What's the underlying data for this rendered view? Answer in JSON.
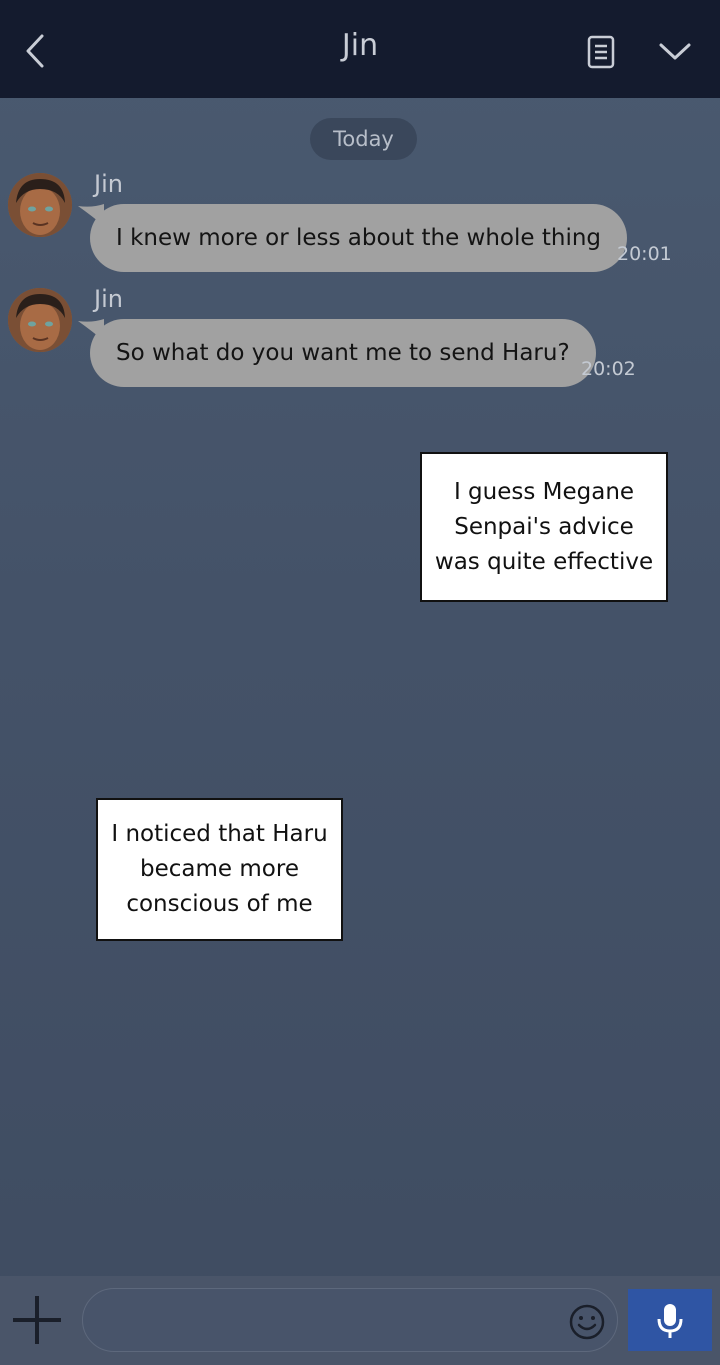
{
  "header": {
    "title": "Jin",
    "back_icon": "chevron-left-icon",
    "notes_icon": "document-icon",
    "collapse_icon": "chevron-down-icon"
  },
  "date_divider": "Today",
  "messages": [
    {
      "sender": "Jin",
      "text": "I knew more or less about the whole thing",
      "time": "20:01"
    },
    {
      "sender": "Jin",
      "text": "So what do you want me to send Haru?",
      "time": "20:02"
    }
  ],
  "narrations": [
    {
      "lines": [
        "I guess Megane",
        "Senpai's advice",
        "was quite effective"
      ]
    },
    {
      "lines": [
        "I noticed that Haru",
        "became more",
        "conscious of me"
      ]
    }
  ],
  "composer": {
    "plus_icon": "plus-icon",
    "emoji_icon": "smiley-icon",
    "mic_icon": "microphone-icon",
    "input_value": ""
  },
  "colors": {
    "header_bg": "#141b2e",
    "chat_bg": "#475770",
    "bubble_bg": "#a1a1a1",
    "mic_button_bg": "#2f55a4"
  }
}
